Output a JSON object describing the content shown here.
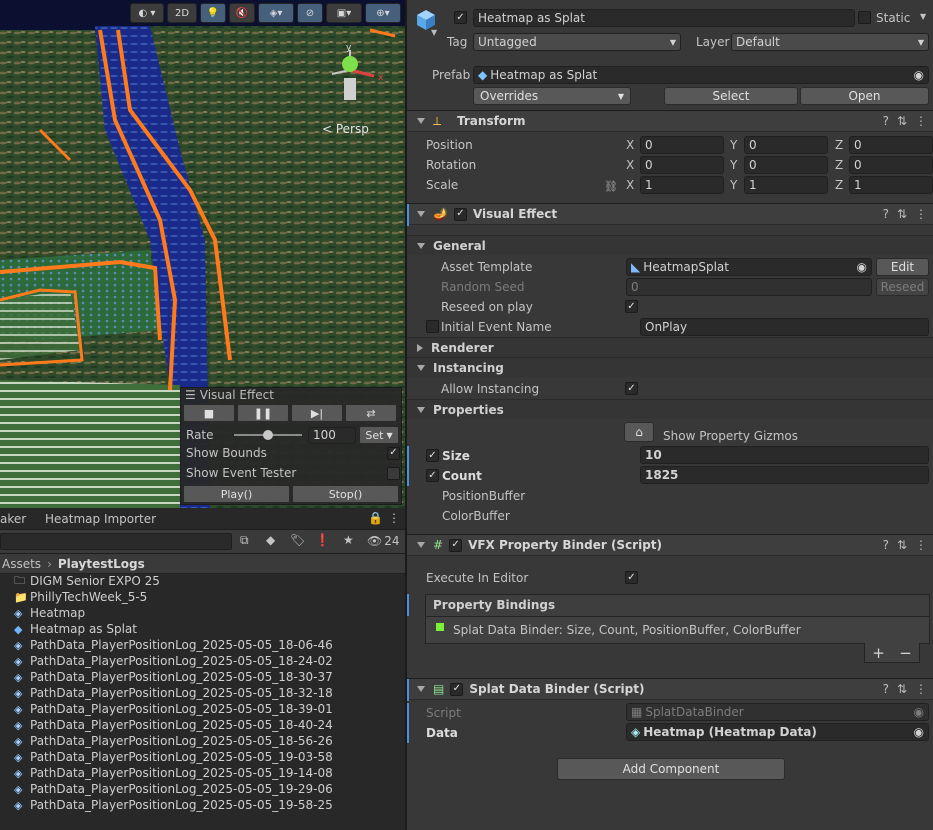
{
  "scene": {
    "toolbar": {
      "shading_label": "",
      "mode_2d_label": "2D"
    },
    "persp_label": "< Persp",
    "vfx_overlay": {
      "title": "Visual Effect",
      "rate_label": "Rate",
      "rate_value": "100",
      "rate_fraction": 0.5,
      "set_label": "Set",
      "show_bounds_label": "Show Bounds",
      "show_bounds_checked": true,
      "show_event_tester_label": "Show Event Tester",
      "play_label": "Play()",
      "stop_label": "Stop()"
    }
  },
  "project": {
    "tabs": [
      "aker",
      "Heatmap Importer"
    ],
    "hidden_count": "24",
    "breadcrumb": [
      "Assets",
      "PlaytestLogs"
    ],
    "items": [
      {
        "name": "DIGM Senior EXPO 25",
        "icon": "folder-outline-icon"
      },
      {
        "name": "PhillyTechWeek_5-5",
        "icon": "folder-icon"
      },
      {
        "name": "Heatmap",
        "icon": "scriptable-asset-icon"
      },
      {
        "name": "Heatmap as Splat",
        "icon": "prefab-icon"
      },
      {
        "name": "PathData_PlayerPositionLog_2025-05-05_18-06-46",
        "icon": "scriptable-asset-icon"
      },
      {
        "name": "PathData_PlayerPositionLog_2025-05-05_18-24-02",
        "icon": "scriptable-asset-icon"
      },
      {
        "name": "PathData_PlayerPositionLog_2025-05-05_18-30-37",
        "icon": "scriptable-asset-icon"
      },
      {
        "name": "PathData_PlayerPositionLog_2025-05-05_18-32-18",
        "icon": "scriptable-asset-icon"
      },
      {
        "name": "PathData_PlayerPositionLog_2025-05-05_18-39-01",
        "icon": "scriptable-asset-icon"
      },
      {
        "name": "PathData_PlayerPositionLog_2025-05-05_18-40-24",
        "icon": "scriptable-asset-icon"
      },
      {
        "name": "PathData_PlayerPositionLog_2025-05-05_18-56-26",
        "icon": "scriptable-asset-icon"
      },
      {
        "name": "PathData_PlayerPositionLog_2025-05-05_19-03-58",
        "icon": "scriptable-asset-icon"
      },
      {
        "name": "PathData_PlayerPositionLog_2025-05-05_19-14-08",
        "icon": "scriptable-asset-icon"
      },
      {
        "name": "PathData_PlayerPositionLog_2025-05-05_19-29-06",
        "icon": "scriptable-asset-icon"
      },
      {
        "name": "PathData_PlayerPositionLog_2025-05-05_19-58-25",
        "icon": "scriptable-asset-icon"
      }
    ]
  },
  "inspector": {
    "object_name": "Heatmap as Splat",
    "active_checked": true,
    "static_label": "Static",
    "tag_label": "Tag",
    "tag_value": "Untagged",
    "layer_label": "Layer",
    "layer_value": "Default",
    "prefab_label": "Prefab",
    "prefab_value": "Heatmap as Splat",
    "overrides_label": "Overrides",
    "select_label": "Select",
    "open_label": "Open",
    "transform": {
      "title": "Transform",
      "rows": [
        {
          "label": "Position",
          "x": "0",
          "y": "0",
          "z": "0"
        },
        {
          "label": "Rotation",
          "x": "0",
          "y": "0",
          "z": "0"
        },
        {
          "label": "Scale",
          "x": "1",
          "y": "1",
          "z": "1"
        }
      ],
      "axis_x": "X",
      "axis_y": "Y",
      "axis_z": "Z"
    },
    "visual_effect": {
      "title": "Visual Effect",
      "general_label": "General",
      "asset_template_label": "Asset Template",
      "asset_template_value": "HeatmapSplat",
      "edit_label": "Edit",
      "random_seed_label": "Random Seed",
      "random_seed_value": "0",
      "reseed_label": "Reseed",
      "reseed_on_play_label": "Reseed on play",
      "initial_event_label": "Initial Event Name",
      "initial_event_value": "OnPlay",
      "renderer_label": "Renderer",
      "instancing_label": "Instancing",
      "allow_instancing_label": "Allow Instancing",
      "properties_label": "Properties",
      "show_gizmos_label": "Show Property Gizmos",
      "size_label": "Size",
      "size_value": "10",
      "count_label": "Count",
      "count_value": "1825",
      "position_buffer_label": "PositionBuffer",
      "color_buffer_label": "ColorBuffer"
    },
    "vfx_binder": {
      "title": "VFX Property Binder (Script)",
      "execute_label": "Execute In Editor",
      "bindings_label": "Property Bindings",
      "binding_item": "Splat Data Binder: Size, Count, PositionBuffer, ColorBuffer",
      "plus": "+",
      "minus": "−"
    },
    "splat_binder": {
      "title": "Splat Data Binder (Script)",
      "script_label": "Script",
      "script_value": "SplatDataBinder",
      "data_label": "Data",
      "data_value": "Heatmap (Heatmap Data)"
    },
    "add_component_label": "Add Component"
  },
  "colors": {
    "accent_blue": "#4a90d9",
    "binding_green": "#7cf03a"
  }
}
